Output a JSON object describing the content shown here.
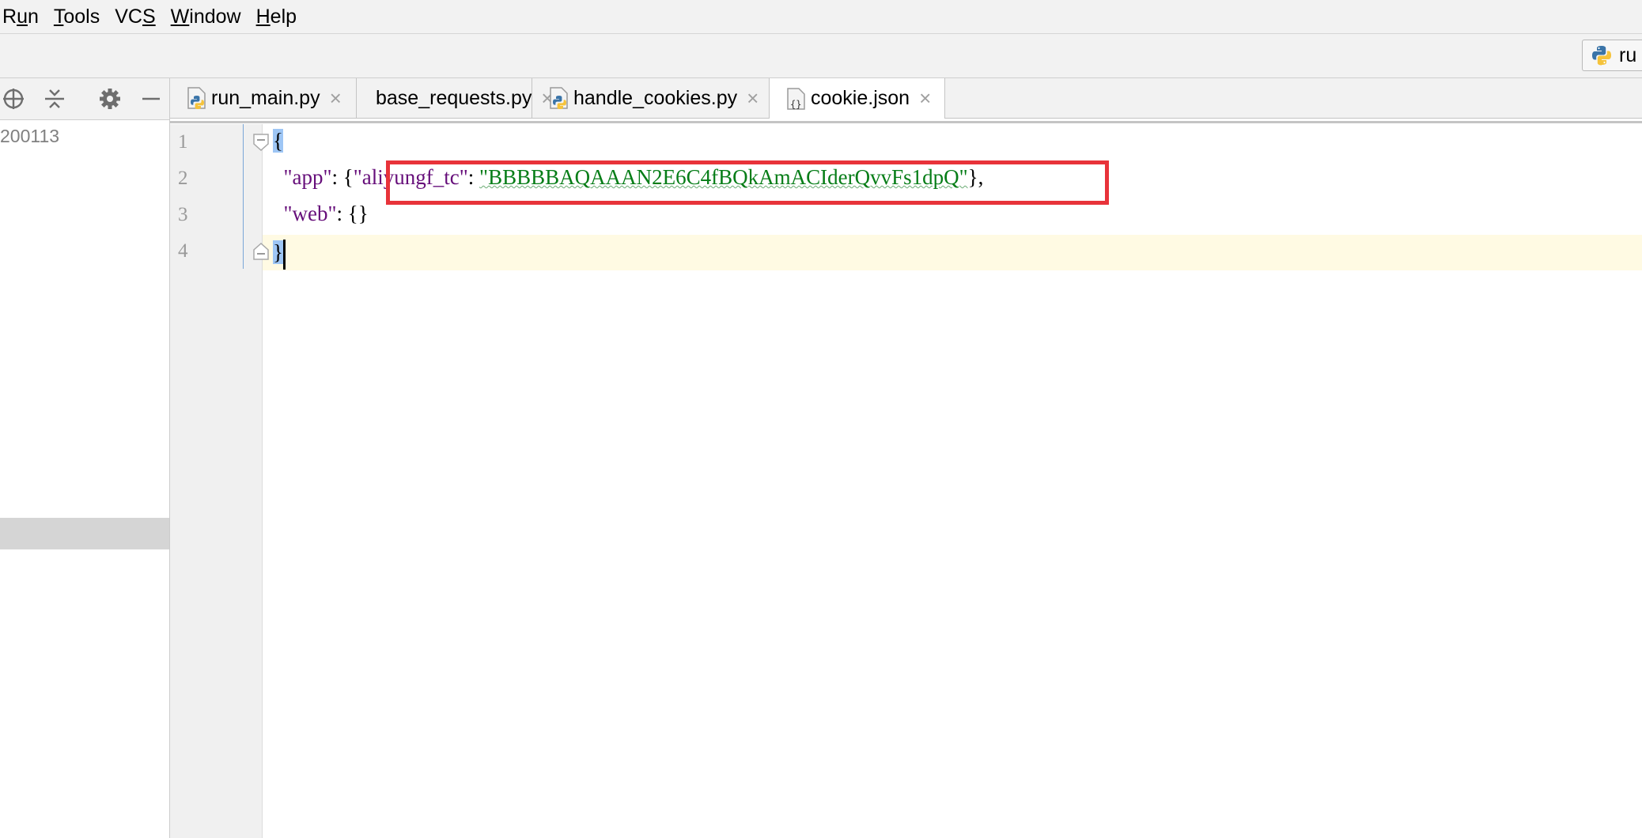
{
  "menubar": {
    "items": [
      {
        "pre": "R",
        "mn": "u",
        "post": "n"
      },
      {
        "pre": "",
        "mn": "T",
        "post": "ools"
      },
      {
        "pre": "VC",
        "mn": "S",
        "post": ""
      },
      {
        "pre": "",
        "mn": "W",
        "post": "indow"
      },
      {
        "pre": "",
        "mn": "H",
        "post": "elp"
      }
    ]
  },
  "toolbar": {
    "run_config_label": "ru"
  },
  "left_panel": {
    "tree_item": "200113"
  },
  "tabs": [
    {
      "label": "run_main.py",
      "icon": "python-file-icon"
    },
    {
      "label": "base_requests.py",
      "icon": "python-file-icon"
    },
    {
      "label": "handle_cookies.py",
      "icon": "python-file-icon"
    },
    {
      "label": "cookie.json",
      "icon": "json-file-icon",
      "active": true
    }
  ],
  "tab_close_glyph": "×",
  "editor": {
    "line_numbers": [
      "1",
      "2",
      "3",
      "4"
    ],
    "line1": {
      "brace": "{"
    },
    "line2": {
      "indent": "  ",
      "key": "\"app\"",
      "colon": ": ",
      "open": "{",
      "inner_key": "\"aliyungf_tc\"",
      "inner_colon": ": ",
      "inner_value": "\"BBBBBAQAAAN2E6C4fBQkAmACIderQvvFs1dpQ\"",
      "close": "},"
    },
    "line3": {
      "indent": "  ",
      "key": "\"web\"",
      "colon": ": ",
      "value": "{}"
    },
    "line4": {
      "brace": "}"
    }
  },
  "colors": {
    "key": "#660e7a",
    "string": "#067d17",
    "annotation_box": "#e8333a",
    "current_line": "#fffae3"
  }
}
